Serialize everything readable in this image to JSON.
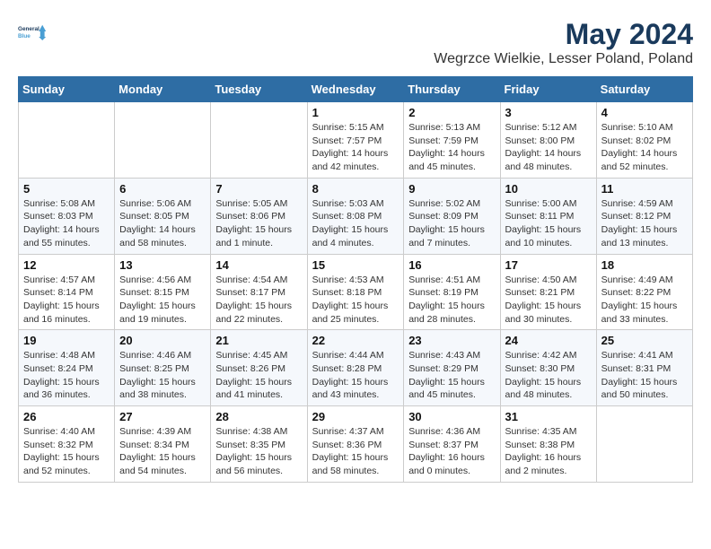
{
  "header": {
    "logo_line1": "General",
    "logo_line2": "Blue",
    "main_title": "May 2024",
    "subtitle": "Wegrzce Wielkie, Lesser Poland, Poland"
  },
  "weekdays": [
    "Sunday",
    "Monday",
    "Tuesday",
    "Wednesday",
    "Thursday",
    "Friday",
    "Saturday"
  ],
  "weeks": [
    [
      {
        "day": "",
        "info": ""
      },
      {
        "day": "",
        "info": ""
      },
      {
        "day": "",
        "info": ""
      },
      {
        "day": "1",
        "info": "Sunrise: 5:15 AM\nSunset: 7:57 PM\nDaylight: 14 hours\nand 42 minutes."
      },
      {
        "day": "2",
        "info": "Sunrise: 5:13 AM\nSunset: 7:59 PM\nDaylight: 14 hours\nand 45 minutes."
      },
      {
        "day": "3",
        "info": "Sunrise: 5:12 AM\nSunset: 8:00 PM\nDaylight: 14 hours\nand 48 minutes."
      },
      {
        "day": "4",
        "info": "Sunrise: 5:10 AM\nSunset: 8:02 PM\nDaylight: 14 hours\nand 52 minutes."
      }
    ],
    [
      {
        "day": "5",
        "info": "Sunrise: 5:08 AM\nSunset: 8:03 PM\nDaylight: 14 hours\nand 55 minutes."
      },
      {
        "day": "6",
        "info": "Sunrise: 5:06 AM\nSunset: 8:05 PM\nDaylight: 14 hours\nand 58 minutes."
      },
      {
        "day": "7",
        "info": "Sunrise: 5:05 AM\nSunset: 8:06 PM\nDaylight: 15 hours\nand 1 minute."
      },
      {
        "day": "8",
        "info": "Sunrise: 5:03 AM\nSunset: 8:08 PM\nDaylight: 15 hours\nand 4 minutes."
      },
      {
        "day": "9",
        "info": "Sunrise: 5:02 AM\nSunset: 8:09 PM\nDaylight: 15 hours\nand 7 minutes."
      },
      {
        "day": "10",
        "info": "Sunrise: 5:00 AM\nSunset: 8:11 PM\nDaylight: 15 hours\nand 10 minutes."
      },
      {
        "day": "11",
        "info": "Sunrise: 4:59 AM\nSunset: 8:12 PM\nDaylight: 15 hours\nand 13 minutes."
      }
    ],
    [
      {
        "day": "12",
        "info": "Sunrise: 4:57 AM\nSunset: 8:14 PM\nDaylight: 15 hours\nand 16 minutes."
      },
      {
        "day": "13",
        "info": "Sunrise: 4:56 AM\nSunset: 8:15 PM\nDaylight: 15 hours\nand 19 minutes."
      },
      {
        "day": "14",
        "info": "Sunrise: 4:54 AM\nSunset: 8:17 PM\nDaylight: 15 hours\nand 22 minutes."
      },
      {
        "day": "15",
        "info": "Sunrise: 4:53 AM\nSunset: 8:18 PM\nDaylight: 15 hours\nand 25 minutes."
      },
      {
        "day": "16",
        "info": "Sunrise: 4:51 AM\nSunset: 8:19 PM\nDaylight: 15 hours\nand 28 minutes."
      },
      {
        "day": "17",
        "info": "Sunrise: 4:50 AM\nSunset: 8:21 PM\nDaylight: 15 hours\nand 30 minutes."
      },
      {
        "day": "18",
        "info": "Sunrise: 4:49 AM\nSunset: 8:22 PM\nDaylight: 15 hours\nand 33 minutes."
      }
    ],
    [
      {
        "day": "19",
        "info": "Sunrise: 4:48 AM\nSunset: 8:24 PM\nDaylight: 15 hours\nand 36 minutes."
      },
      {
        "day": "20",
        "info": "Sunrise: 4:46 AM\nSunset: 8:25 PM\nDaylight: 15 hours\nand 38 minutes."
      },
      {
        "day": "21",
        "info": "Sunrise: 4:45 AM\nSunset: 8:26 PM\nDaylight: 15 hours\nand 41 minutes."
      },
      {
        "day": "22",
        "info": "Sunrise: 4:44 AM\nSunset: 8:28 PM\nDaylight: 15 hours\nand 43 minutes."
      },
      {
        "day": "23",
        "info": "Sunrise: 4:43 AM\nSunset: 8:29 PM\nDaylight: 15 hours\nand 45 minutes."
      },
      {
        "day": "24",
        "info": "Sunrise: 4:42 AM\nSunset: 8:30 PM\nDaylight: 15 hours\nand 48 minutes."
      },
      {
        "day": "25",
        "info": "Sunrise: 4:41 AM\nSunset: 8:31 PM\nDaylight: 15 hours\nand 50 minutes."
      }
    ],
    [
      {
        "day": "26",
        "info": "Sunrise: 4:40 AM\nSunset: 8:32 PM\nDaylight: 15 hours\nand 52 minutes."
      },
      {
        "day": "27",
        "info": "Sunrise: 4:39 AM\nSunset: 8:34 PM\nDaylight: 15 hours\nand 54 minutes."
      },
      {
        "day": "28",
        "info": "Sunrise: 4:38 AM\nSunset: 8:35 PM\nDaylight: 15 hours\nand 56 minutes."
      },
      {
        "day": "29",
        "info": "Sunrise: 4:37 AM\nSunset: 8:36 PM\nDaylight: 15 hours\nand 58 minutes."
      },
      {
        "day": "30",
        "info": "Sunrise: 4:36 AM\nSunset: 8:37 PM\nDaylight: 16 hours\nand 0 minutes."
      },
      {
        "day": "31",
        "info": "Sunrise: 4:35 AM\nSunset: 8:38 PM\nDaylight: 16 hours\nand 2 minutes."
      },
      {
        "day": "",
        "info": ""
      }
    ]
  ]
}
